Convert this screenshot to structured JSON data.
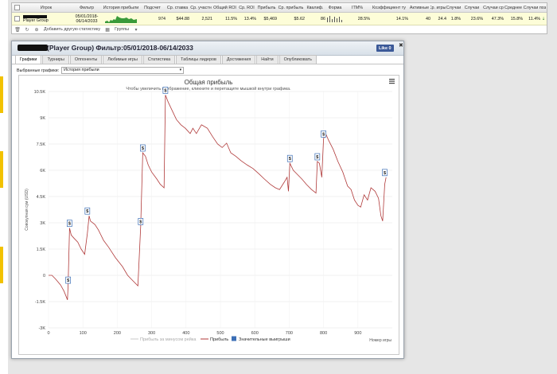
{
  "table": {
    "headers": [
      "Игрок",
      "Фильтр",
      "История прибыли",
      "Подсчет",
      "Ср. ставка",
      "Ср. участн",
      "Общий ROI",
      "Ср. ROI",
      "Прибыль",
      "Ср. прибыль",
      "Квалиф.",
      "Форма",
      "ITM%",
      "Коэффициент ту",
      "Активные",
      "Ср. игры /",
      "Случаи",
      "Случаи",
      "Случаи ср",
      "Среднее",
      "Случаи поз"
    ],
    "row": {
      "player_suffix": "Player Group",
      "filter_line1": "05/01/2018-",
      "filter_line2": "06/14/2033",
      "count": "974",
      "avg_stake": "$44.88",
      "avg_entrants": "2,521",
      "total_roi": "11.5%",
      "avg_roi": "13.4%",
      "profit": "$5,469",
      "avg_profit": "$5.62",
      "qualif": "86",
      "form": "",
      "itm": "28.5%",
      "coef": "14.1%",
      "active": "40",
      "avg_games": "24.4",
      "c1": "1.8%",
      "c2": "23.6%",
      "c3": "47.3%",
      "c4": "15.8%",
      "c5": "11.4%",
      "trend": "⇣"
    },
    "footer_add_stats": "Добавить другую статистику",
    "footer_groups": "Группы"
  },
  "panel": {
    "title": "(Player Group) Фильтр:05/01/2018-06/14/2033",
    "like_label": "Like 0",
    "close": "✖",
    "tabs": [
      "Графики",
      "Турниры",
      "Оппоненты",
      "Любимые игры",
      "Статистика",
      "Таблицы лидеров",
      "Достижения",
      "Найти",
      "Опубликовать"
    ],
    "active_tab": 0,
    "graph_select_label": "Выбранные графики:",
    "graph_select_value": "История прибыли"
  },
  "chart_data": {
    "type": "line",
    "title": "Общая прибыль",
    "subtitle": "Чтобы увеличить изображение, кликните и перетащите мышкой внутри графика.",
    "ylabel": "Совокупная сум (USD)",
    "xlabel": "Номер игры",
    "xlim": [
      0,
      1000
    ],
    "ylim": [
      -3000,
      10500
    ],
    "x_ticks": [
      0,
      100,
      200,
      300,
      400,
      500,
      600,
      700,
      800,
      900
    ],
    "y_ticks": [
      -3000,
      -1500,
      0,
      1500,
      3000,
      4500,
      6000,
      7500,
      9000,
      10500
    ],
    "y_tick_labels": [
      "-3K",
      "-1.5K",
      "0",
      "1.5K",
      "3K",
      "4.5K",
      "6K",
      "7.5K",
      "9K",
      "10.5K"
    ],
    "grid": true,
    "legend_position": "bottom",
    "legend": [
      "Прибыль за минусом рейка",
      "Прибыль",
      "Значительные выигрыши"
    ],
    "series": [
      {
        "name": "Прибыль",
        "color": "#b03a3a",
        "points": [
          [
            0,
            0
          ],
          [
            10,
            0
          ],
          [
            20,
            -200
          ],
          [
            35,
            -550
          ],
          [
            45,
            -900
          ],
          [
            55,
            -1400
          ],
          [
            57,
            -550
          ],
          [
            61,
            2700
          ],
          [
            66,
            2300
          ],
          [
            75,
            2100
          ],
          [
            85,
            1900
          ],
          [
            95,
            1500
          ],
          [
            105,
            1200
          ],
          [
            113,
            2400
          ],
          [
            118,
            3400
          ],
          [
            122,
            3100
          ],
          [
            135,
            2900
          ],
          [
            145,
            2600
          ],
          [
            160,
            2000
          ],
          [
            175,
            1600
          ],
          [
            195,
            1000
          ],
          [
            215,
            500
          ],
          [
            230,
            0
          ],
          [
            245,
            -300
          ],
          [
            260,
            -600
          ],
          [
            268,
            2800
          ],
          [
            274,
            7000
          ],
          [
            282,
            6800
          ],
          [
            290,
            6300
          ],
          [
            300,
            5900
          ],
          [
            315,
            5500
          ],
          [
            325,
            5200
          ],
          [
            336,
            5000
          ],
          [
            340,
            10300
          ],
          [
            348,
            9900
          ],
          [
            360,
            9400
          ],
          [
            372,
            8900
          ],
          [
            385,
            8600
          ],
          [
            398,
            8400
          ],
          [
            412,
            8100
          ],
          [
            420,
            8400
          ],
          [
            430,
            8100
          ],
          [
            445,
            8600
          ],
          [
            462,
            8400
          ],
          [
            478,
            7900
          ],
          [
            492,
            7500
          ],
          [
            505,
            7300
          ],
          [
            518,
            7550
          ],
          [
            530,
            7000
          ],
          [
            545,
            6800
          ],
          [
            560,
            6550
          ],
          [
            578,
            6300
          ],
          [
            595,
            6100
          ],
          [
            612,
            5800
          ],
          [
            628,
            5500
          ],
          [
            645,
            5200
          ],
          [
            660,
            5000
          ],
          [
            672,
            4900
          ],
          [
            685,
            5300
          ],
          [
            694,
            5600
          ],
          [
            698,
            4800
          ],
          [
            702,
            6400
          ],
          [
            712,
            6000
          ],
          [
            722,
            5800
          ],
          [
            737,
            5500
          ],
          [
            750,
            5200
          ],
          [
            765,
            4900
          ],
          [
            778,
            4700
          ],
          [
            782,
            6500
          ],
          [
            788,
            6400
          ],
          [
            795,
            5600
          ],
          [
            800,
            7800
          ],
          [
            806,
            8100
          ],
          [
            815,
            7700
          ],
          [
            828,
            7200
          ],
          [
            842,
            6500
          ],
          [
            856,
            5900
          ],
          [
            870,
            5100
          ],
          [
            880,
            4900
          ],
          [
            890,
            4300
          ],
          [
            900,
            4000
          ],
          [
            908,
            3900
          ],
          [
            918,
            4600
          ],
          [
            928,
            4300
          ],
          [
            938,
            5000
          ],
          [
            950,
            4800
          ],
          [
            960,
            4400
          ],
          [
            967,
            3400
          ],
          [
            972,
            3100
          ],
          [
            978,
            5200
          ],
          [
            982,
            5600
          ]
        ]
      },
      {
        "name": "Прибыль за минусом рейка",
        "color": "#c8c8c8",
        "points": []
      }
    ],
    "big_wins": [
      {
        "x": 57,
        "y": -550,
        "label": "$"
      },
      {
        "x": 61,
        "y": 2700,
        "label": "$"
      },
      {
        "x": 113,
        "y": 3400,
        "label": "$"
      },
      {
        "x": 268,
        "y": 2800,
        "label": "$"
      },
      {
        "x": 274,
        "y": 7000,
        "label": "$"
      },
      {
        "x": 340,
        "y": 10300,
        "label": "$"
      },
      {
        "x": 702,
        "y": 6400,
        "label": "$"
      },
      {
        "x": 782,
        "y": 6500,
        "label": "$"
      },
      {
        "x": 800,
        "y": 7800,
        "label": "$"
      },
      {
        "x": 978,
        "y": 5600,
        "label": "$"
      }
    ]
  }
}
